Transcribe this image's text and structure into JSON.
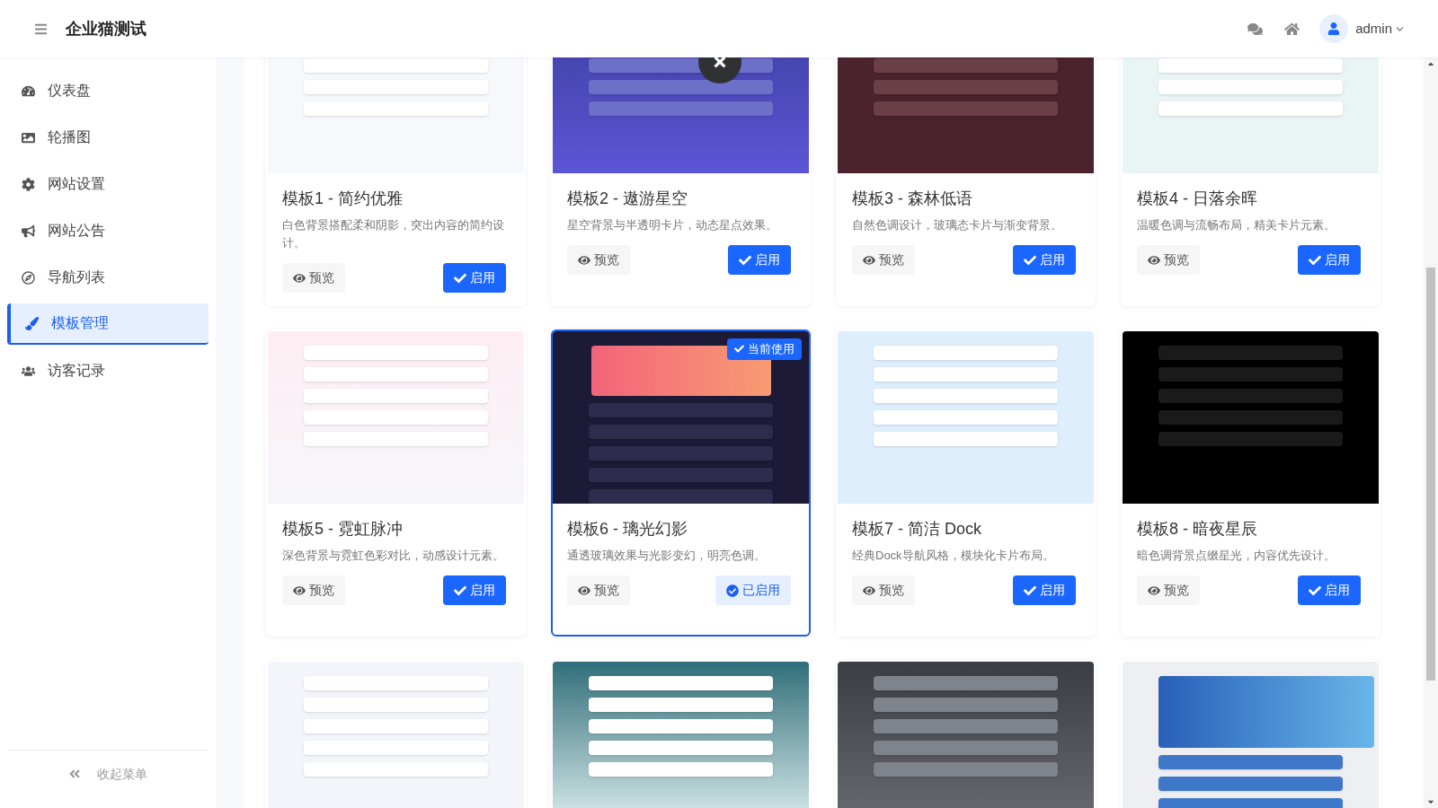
{
  "header": {
    "title": "企业猫测试",
    "user": "admin"
  },
  "sidebar": {
    "items": [
      {
        "label": "仪表盘",
        "selected": false
      },
      {
        "label": "轮播图",
        "selected": false
      },
      {
        "label": "网站设置",
        "selected": false
      },
      {
        "label": "网站公告",
        "selected": false
      },
      {
        "label": "导航列表",
        "selected": false
      },
      {
        "label": "模板管理",
        "selected": true
      },
      {
        "label": "访客记录",
        "selected": false
      }
    ],
    "collapse": "收起菜单"
  },
  "templates": [
    {
      "kind": "light",
      "name": "模板1 - 简约优雅",
      "description": "白色背景搭配柔和阴影，突出内容的简约设计。",
      "preview": "预览",
      "action": "启用",
      "selected": false
    },
    {
      "kind": "purple",
      "name": "模板2 - 遨游星空",
      "description": "星空背景与半透明卡片，动态星点效果。",
      "preview": "预览",
      "action": "启用",
      "selected": false
    },
    {
      "kind": "maroon",
      "name": "模板3 - 森林低语",
      "description": "自然色调设计，玻璃态卡片与渐变背景。",
      "preview": "预览",
      "action": "启用",
      "selected": false
    },
    {
      "kind": "mint",
      "name": "模板4 - 日落余晖",
      "description": "温暖色调与流畅布局，精美卡片元素。",
      "preview": "预览",
      "action": "启用",
      "selected": false
    },
    {
      "kind": "pink",
      "name": "模板5 - 霓虹脉冲",
      "description": "深色背景与霓虹色彩对比，动感设计元素。",
      "preview": "预览",
      "action": "启用",
      "selected": false
    },
    {
      "kind": "navy",
      "name": "模板6 - 璃光幻影",
      "description": "通透玻璃效果与光影变幻，明亮色调。",
      "preview": "预览",
      "action": "已启用",
      "badge": "当前使用",
      "selected": true
    },
    {
      "kind": "sky",
      "name": "模板7 - 简洁 Dock",
      "description": "经典Dock导航风格，模块化卡片布局。",
      "preview": "预览",
      "action": "启用",
      "selected": false
    },
    {
      "kind": "black",
      "name": "模板8 - 暗夜星辰",
      "description": "暗色调背景点缀星光，内容优先设计。",
      "preview": "预览",
      "action": "启用",
      "selected": false
    },
    {
      "kind": "lavender"
    },
    {
      "kind": "teal"
    },
    {
      "kind": "city"
    },
    {
      "kind": "banner"
    }
  ]
}
